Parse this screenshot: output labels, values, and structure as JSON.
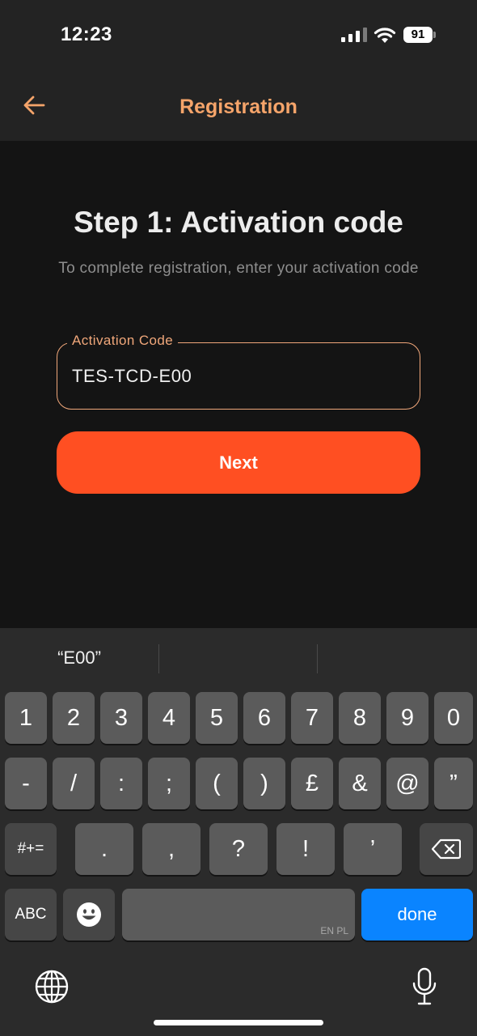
{
  "status_bar": {
    "time": "12:23",
    "battery": "91"
  },
  "app_bar": {
    "title": "Registration"
  },
  "step": {
    "title": "Step 1: Activation code",
    "subtitle": "To complete registration, enter your activation code"
  },
  "activation_field": {
    "label": "Activation Code",
    "value": "TES-TCD-E00"
  },
  "next_button": {
    "label": "Next"
  },
  "keyboard": {
    "suggestion": "“E00”",
    "row1": [
      "1",
      "2",
      "3",
      "4",
      "5",
      "6",
      "7",
      "8",
      "9",
      "0"
    ],
    "row2": [
      "-",
      "/",
      ":",
      ";",
      "(",
      ")",
      "£",
      "&",
      "@",
      "”"
    ],
    "row3": [
      "#+=",
      ".",
      ",",
      "?",
      "!",
      "’"
    ],
    "row4": {
      "abc": "ABC",
      "space_sub": "EN PL",
      "done": "done"
    }
  },
  "colors": {
    "accent": "#f5a46a",
    "primary_button": "#ff4f22",
    "done_key": "#0a84ff"
  }
}
